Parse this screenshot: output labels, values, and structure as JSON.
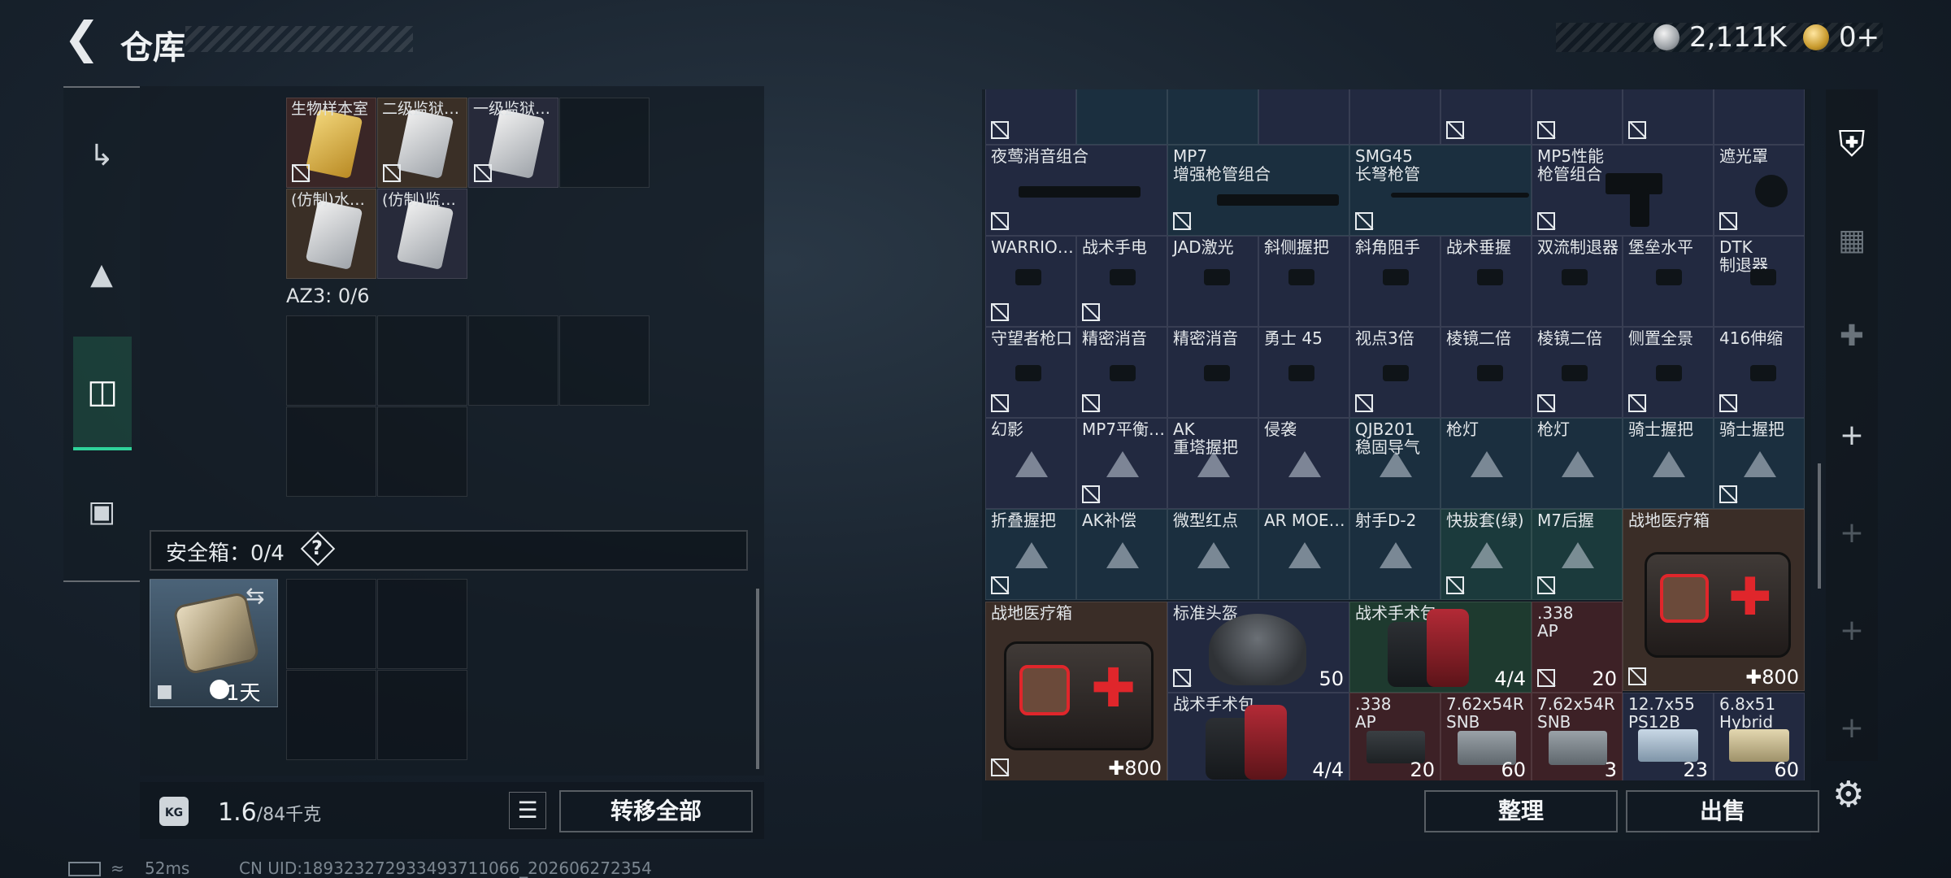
{
  "header": {
    "back_icon": "back-arrow-icon",
    "title": "仓库",
    "currency1": "2,111K",
    "currency2": "0+"
  },
  "nav": {
    "items": [
      "gun-icon",
      "backpack-icon",
      "safe-case-icon",
      "briefcase-icon"
    ],
    "active": 2
  },
  "left": {
    "top_items": [
      {
        "label": "生物样本室",
        "color": "#3a2626"
      },
      {
        "label": "二级监狱…",
        "color": "#3a2f26"
      },
      {
        "label": "一级监狱…",
        "color": "#272a3a"
      },
      {
        "label": "(仿制)水…",
        "color": "#3a2f26"
      },
      {
        "label": "(仿制)监…",
        "color": "#272a3a"
      }
    ],
    "az3_label": "AZ3: 0/6",
    "safe_label": "安全箱：0/4",
    "safe_help": "?",
    "safe_timer": "1天",
    "weight_value": "1.6",
    "weight_capacity": "/84千克",
    "kg_icon": "KG",
    "transfer_all": "转移全部"
  },
  "right": {
    "row0": [
      "",
      "",
      "",
      "",
      "",
      "",
      "",
      ""
    ],
    "items": [
      {
        "l1": "夜莺消音组合",
        "l2": "",
        "bg": "c-navy"
      },
      {
        "l1": "MP7",
        "l2": "增强枪管组合",
        "bg": "c-blue"
      },
      {
        "l1": "SMG45",
        "l2": "长弩枪管",
        "bg": "c-blue"
      },
      {
        "l1": "MP5性能",
        "l2": "枪管组合",
        "bg": "c-navy"
      },
      {
        "l1": "遮光罩",
        "l2": "",
        "bg": "c-navy"
      },
      {
        "l1": "WARRIO…",
        "l2": "",
        "bg": "c-navy"
      },
      {
        "l1": "战术手电",
        "l2": "",
        "bg": "c-navy"
      },
      {
        "l1": "JAD激光",
        "l2": "",
        "bg": "c-navy"
      },
      {
        "l1": "斜侧握把",
        "l2": "",
        "bg": "c-navy"
      },
      {
        "l1": "斜角阻手",
        "l2": "",
        "bg": "c-navy"
      },
      {
        "l1": "战术垂握",
        "l2": "",
        "bg": "c-navy"
      },
      {
        "l1": "双流制退器",
        "l2": "",
        "bg": "c-navy"
      },
      {
        "l1": "堡垒水平",
        "l2": "",
        "bg": "c-navy"
      },
      {
        "l1": "DTK",
        "l2": "制退器",
        "bg": "c-navy"
      },
      {
        "l1": "守望者枪口",
        "l2": "",
        "bg": "c-navy"
      },
      {
        "l1": "精密消音",
        "l2": "",
        "bg": "c-navy"
      },
      {
        "l1": "精密消音",
        "l2": "",
        "bg": "c-navy"
      },
      {
        "l1": "勇士 45",
        "l2": "",
        "bg": "c-navy"
      },
      {
        "l1": "视点3倍",
        "l2": "",
        "bg": "c-navy"
      },
      {
        "l1": "棱镜二倍",
        "l2": "",
        "bg": "c-navy"
      },
      {
        "l1": "棱镜二倍",
        "l2": "",
        "bg": "c-navy"
      },
      {
        "l1": "侧置全景",
        "l2": "",
        "bg": "c-navy"
      },
      {
        "l1": "416伸缩",
        "l2": "",
        "bg": "c-navy"
      },
      {
        "l1": "幻影",
        "l2": "",
        "bg": "c-navy"
      },
      {
        "l1": "MP7平衡…",
        "l2": "",
        "bg": "c-navy"
      },
      {
        "l1": "AK",
        "l2": "重塔握把",
        "bg": "c-navy"
      },
      {
        "l1": "侵袭",
        "l2": "",
        "bg": "c-navy"
      },
      {
        "l1": "QJB201",
        "l2": "稳固导气",
        "bg": "c-blue"
      },
      {
        "l1": "枪灯",
        "l2": "",
        "bg": "c-blue"
      },
      {
        "l1": "枪灯",
        "l2": "",
        "bg": "c-blue"
      },
      {
        "l1": "骑士握把",
        "l2": "",
        "bg": "c-blue"
      },
      {
        "l1": "骑士握把",
        "l2": "",
        "bg": "c-blue"
      },
      {
        "l1": "折叠握把",
        "l2": "",
        "bg": "c-blue"
      },
      {
        "l1": "AK补偿",
        "l2": "",
        "bg": "c-blue"
      },
      {
        "l1": "微型红点",
        "l2": "",
        "bg": "c-blue"
      },
      {
        "l1": "AR MOE…",
        "l2": "",
        "bg": "c-blue"
      },
      {
        "l1": "射手D-2",
        "l2": "",
        "bg": "c-blue"
      },
      {
        "l1": "快拔套(绿)",
        "l2": "",
        "bg": "c-teal"
      },
      {
        "l1": "M7后握",
        "l2": "",
        "bg": "c-teal"
      }
    ],
    "big_items": [
      {
        "name": "firstaid-a",
        "l1": "战地医疗箱",
        "count": "✚800"
      },
      {
        "name": "firstaid-b",
        "l1": "战地医疗箱",
        "count": "✚800"
      },
      {
        "name": "helmet",
        "l1": "标准头盔",
        "count": "50"
      },
      {
        "name": "surgkit-a",
        "l1": "战术手术包",
        "count": "4/4"
      },
      {
        "name": "surgkit-b",
        "l1": "战术手术包",
        "count": "4/4"
      },
      {
        "name": "ammo338-a",
        "l1": ".338",
        "l2": "AP",
        "count": "20"
      },
      {
        "name": "ammo338-b",
        "l1": ".338",
        "l2": "AP",
        "count": "20"
      },
      {
        "name": "ammo762-a",
        "l1": "7.62x54R",
        "l2": "SNB",
        "count": "60"
      },
      {
        "name": "ammo762-b",
        "l1": "7.62x54R",
        "l2": "SNB",
        "count": "3"
      },
      {
        "name": "ammo127",
        "l1": "12.7x55",
        "l2": "PS12B",
        "count": "23"
      },
      {
        "name": "ammo68",
        "l1": "6.8x51",
        "l2": "Hybrid",
        "count": "60"
      }
    ],
    "organize": "整理",
    "sell": "出售"
  },
  "rail": [
    "armor-icon",
    "rig-icon",
    "medkit-plus-icon",
    "plus-icon",
    "plus-icon",
    "plus-icon",
    "plus-icon"
  ],
  "status": {
    "ping": "52ms",
    "uid": "CN UID:1893232729334937110​66_202606272354"
  }
}
